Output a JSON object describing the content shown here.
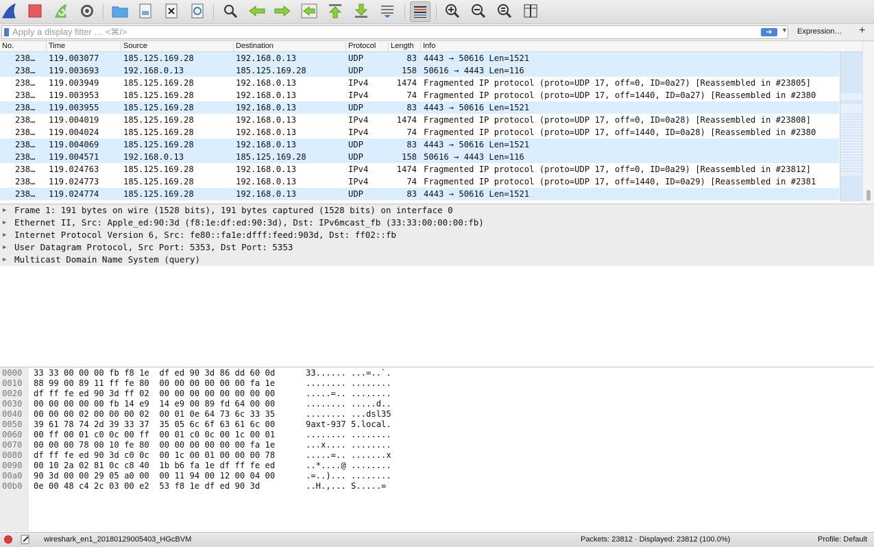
{
  "filter": {
    "placeholder": "Apply a display filter … <⌘/>",
    "apply_icon": "arrow-right",
    "expression_label": "Expression…",
    "add_label": "+"
  },
  "toolbar": {
    "icons": [
      "shark-fin-icon",
      "stop-icon",
      "restart-icon",
      "options-gear-icon",
      "open-folder-icon",
      "save-file-icon",
      "close-file-icon",
      "reload-icon",
      "find-icon",
      "back-arrow-icon",
      "forward-arrow-icon",
      "go-to-packet-icon",
      "first-packet-icon",
      "last-packet-icon",
      "autoscroll-icon",
      "colorize-icon",
      "zoom-in-icon",
      "zoom-out-icon",
      "zoom-normal-icon",
      "resize-columns-icon"
    ]
  },
  "columns": [
    "No.",
    "Time",
    "Source",
    "Destination",
    "Protocol",
    "Length",
    "Info"
  ],
  "packets": [
    {
      "no": "238…",
      "time": "119.003077",
      "src": "185.125.169.28",
      "dst": "192.168.0.13",
      "proto": "UDP",
      "len": "83",
      "info": "4443 → 50616 Len=1521"
    },
    {
      "no": "238…",
      "time": "119.003693",
      "src": "192.168.0.13",
      "dst": "185.125.169.28",
      "proto": "UDP",
      "len": "158",
      "info": "50616 → 4443 Len=116"
    },
    {
      "no": "238…",
      "time": "119.003949",
      "src": "185.125.169.28",
      "dst": "192.168.0.13",
      "proto": "IPv4",
      "len": "1474",
      "info": "Fragmented IP protocol (proto=UDP 17, off=0, ID=0a27) [Reassembled in #23805]"
    },
    {
      "no": "238…",
      "time": "119.003953",
      "src": "185.125.169.28",
      "dst": "192.168.0.13",
      "proto": "IPv4",
      "len": "74",
      "info": "Fragmented IP protocol (proto=UDP 17, off=1440, ID=0a27) [Reassembled in #2380"
    },
    {
      "no": "238…",
      "time": "119.003955",
      "src": "185.125.169.28",
      "dst": "192.168.0.13",
      "proto": "UDP",
      "len": "83",
      "info": "4443 → 50616 Len=1521"
    },
    {
      "no": "238…",
      "time": "119.004019",
      "src": "185.125.169.28",
      "dst": "192.168.0.13",
      "proto": "IPv4",
      "len": "1474",
      "info": "Fragmented IP protocol (proto=UDP 17, off=0, ID=0a28) [Reassembled in #23808]"
    },
    {
      "no": "238…",
      "time": "119.004024",
      "src": "185.125.169.28",
      "dst": "192.168.0.13",
      "proto": "IPv4",
      "len": "74",
      "info": "Fragmented IP protocol (proto=UDP 17, off=1440, ID=0a28) [Reassembled in #2380"
    },
    {
      "no": "238…",
      "time": "119.004069",
      "src": "185.125.169.28",
      "dst": "192.168.0.13",
      "proto": "UDP",
      "len": "83",
      "info": "4443 → 50616 Len=1521"
    },
    {
      "no": "238…",
      "time": "119.004571",
      "src": "192.168.0.13",
      "dst": "185.125.169.28",
      "proto": "UDP",
      "len": "158",
      "info": "50616 → 4443 Len=116"
    },
    {
      "no": "238…",
      "time": "119.024763",
      "src": "185.125.169.28",
      "dst": "192.168.0.13",
      "proto": "IPv4",
      "len": "1474",
      "info": "Fragmented IP protocol (proto=UDP 17, off=0, ID=0a29) [Reassembled in #23812]"
    },
    {
      "no": "238…",
      "time": "119.024773",
      "src": "185.125.169.28",
      "dst": "192.168.0.13",
      "proto": "IPv4",
      "len": "74",
      "info": "Fragmented IP protocol (proto=UDP 17, off=1440, ID=0a29) [Reassembled in #2381"
    },
    {
      "no": "238…",
      "time": "119.024774",
      "src": "185.125.169.28",
      "dst": "192.168.0.13",
      "proto": "UDP",
      "len": "83",
      "info": "4443 → 50616 Len=1521"
    }
  ],
  "details": [
    "Frame 1: 191 bytes on wire (1528 bits), 191 bytes captured (1528 bits) on interface 0",
    "Ethernet II, Src: Apple_ed:90:3d (f8:1e:df:ed:90:3d), Dst: IPv6mcast_fb (33:33:00:00:00:fb)",
    "Internet Protocol Version 6, Src: fe80::fa1e:dfff:feed:903d, Dst: ff02::fb",
    "User Datagram Protocol, Src Port: 5353, Dst Port: 5353",
    "Multicast Domain Name System (query)"
  ],
  "bytes": [
    {
      "offset": "0000",
      "hex": "33 33 00 00 00 fb f8 1e  df ed 90 3d 86 dd 60 0d",
      "ascii": "33...... ...=..`."
    },
    {
      "offset": "0010",
      "hex": "88 99 00 89 11 ff fe 80  00 00 00 00 00 00 fa 1e",
      "ascii": "........ ........"
    },
    {
      "offset": "0020",
      "hex": "df ff fe ed 90 3d ff 02  00 00 00 00 00 00 00 00",
      "ascii": ".....=.. ........"
    },
    {
      "offset": "0030",
      "hex": "00 00 00 00 00 fb 14 e9  14 e9 00 89 fd 64 00 00",
      "ascii": "........ .....d.."
    },
    {
      "offset": "0040",
      "hex": "00 00 00 02 00 00 00 02  00 01 0e 64 73 6c 33 35",
      "ascii": "........ ...dsl35"
    },
    {
      "offset": "0050",
      "hex": "39 61 78 74 2d 39 33 37  35 05 6c 6f 63 61 6c 00",
      "ascii": "9axt-937 5.local."
    },
    {
      "offset": "0060",
      "hex": "00 ff 00 01 c0 0c 00 ff  00 01 c0 0c 00 1c 00 01",
      "ascii": "........ ........"
    },
    {
      "offset": "0070",
      "hex": "00 00 00 78 00 10 fe 80  00 00 00 00 00 00 fa 1e",
      "ascii": "...x.... ........"
    },
    {
      "offset": "0080",
      "hex": "df ff fe ed 90 3d c0 0c  00 1c 00 01 00 00 00 78",
      "ascii": ".....=.. .......x"
    },
    {
      "offset": "0090",
      "hex": "00 10 2a 02 81 0c c8 40  1b b6 fa 1e df ff fe ed",
      "ascii": "..*....@ ........"
    },
    {
      "offset": "00a0",
      "hex": "90 3d 00 00 29 05 a0 00  00 11 94 00 12 00 04 00",
      "ascii": ".=..)... ........"
    },
    {
      "offset": "00b0",
      "hex": "0e 00 48 c4 2c 03 00 e2  53 f8 1e df ed 90 3d",
      "ascii": "..H.,... S.....="
    }
  ],
  "status": {
    "file": "wireshark_en1_20180129005403_HGcBVM",
    "packets": "Packets: 23812 · Displayed: 23812 (100.0%)",
    "profile": "Profile: Default"
  },
  "colors": {
    "udp_row": "#daeeff",
    "accent": "#4a86e0",
    "stop": "#e0393e"
  }
}
